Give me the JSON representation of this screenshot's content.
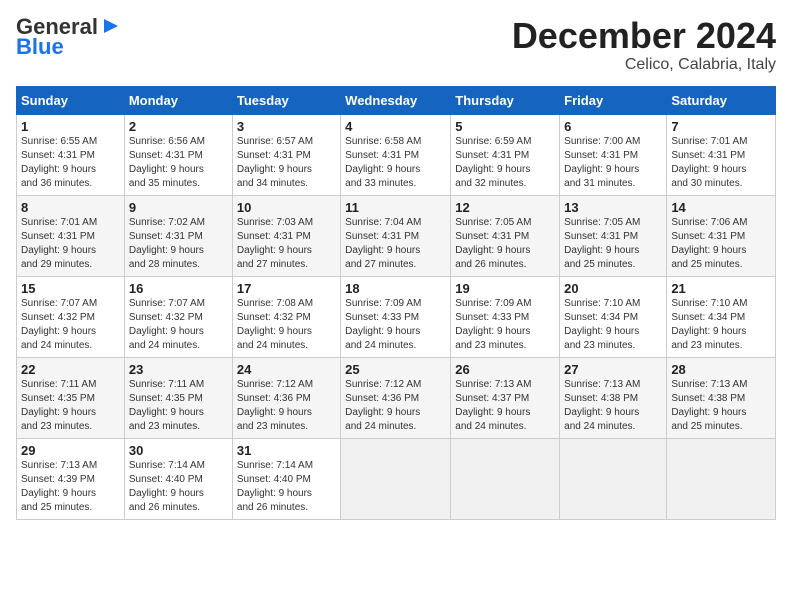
{
  "header": {
    "logo_general": "General",
    "logo_blue": "Blue",
    "month_title": "December 2024",
    "location": "Celico, Calabria, Italy"
  },
  "weekdays": [
    "Sunday",
    "Monday",
    "Tuesday",
    "Wednesday",
    "Thursday",
    "Friday",
    "Saturday"
  ],
  "weeks": [
    [
      {
        "day": "1",
        "info": "Sunrise: 6:55 AM\nSunset: 4:31 PM\nDaylight: 9 hours\nand 36 minutes."
      },
      {
        "day": "2",
        "info": "Sunrise: 6:56 AM\nSunset: 4:31 PM\nDaylight: 9 hours\nand 35 minutes."
      },
      {
        "day": "3",
        "info": "Sunrise: 6:57 AM\nSunset: 4:31 PM\nDaylight: 9 hours\nand 34 minutes."
      },
      {
        "day": "4",
        "info": "Sunrise: 6:58 AM\nSunset: 4:31 PM\nDaylight: 9 hours\nand 33 minutes."
      },
      {
        "day": "5",
        "info": "Sunrise: 6:59 AM\nSunset: 4:31 PM\nDaylight: 9 hours\nand 32 minutes."
      },
      {
        "day": "6",
        "info": "Sunrise: 7:00 AM\nSunset: 4:31 PM\nDaylight: 9 hours\nand 31 minutes."
      },
      {
        "day": "7",
        "info": "Sunrise: 7:01 AM\nSunset: 4:31 PM\nDaylight: 9 hours\nand 30 minutes."
      }
    ],
    [
      {
        "day": "8",
        "info": "Sunrise: 7:01 AM\nSunset: 4:31 PM\nDaylight: 9 hours\nand 29 minutes."
      },
      {
        "day": "9",
        "info": "Sunrise: 7:02 AM\nSunset: 4:31 PM\nDaylight: 9 hours\nand 28 minutes."
      },
      {
        "day": "10",
        "info": "Sunrise: 7:03 AM\nSunset: 4:31 PM\nDaylight: 9 hours\nand 27 minutes."
      },
      {
        "day": "11",
        "info": "Sunrise: 7:04 AM\nSunset: 4:31 PM\nDaylight: 9 hours\nand 27 minutes."
      },
      {
        "day": "12",
        "info": "Sunrise: 7:05 AM\nSunset: 4:31 PM\nDaylight: 9 hours\nand 26 minutes."
      },
      {
        "day": "13",
        "info": "Sunrise: 7:05 AM\nSunset: 4:31 PM\nDaylight: 9 hours\nand 25 minutes."
      },
      {
        "day": "14",
        "info": "Sunrise: 7:06 AM\nSunset: 4:31 PM\nDaylight: 9 hours\nand 25 minutes."
      }
    ],
    [
      {
        "day": "15",
        "info": "Sunrise: 7:07 AM\nSunset: 4:32 PM\nDaylight: 9 hours\nand 24 minutes."
      },
      {
        "day": "16",
        "info": "Sunrise: 7:07 AM\nSunset: 4:32 PM\nDaylight: 9 hours\nand 24 minutes."
      },
      {
        "day": "17",
        "info": "Sunrise: 7:08 AM\nSunset: 4:32 PM\nDaylight: 9 hours\nand 24 minutes."
      },
      {
        "day": "18",
        "info": "Sunrise: 7:09 AM\nSunset: 4:33 PM\nDaylight: 9 hours\nand 24 minutes."
      },
      {
        "day": "19",
        "info": "Sunrise: 7:09 AM\nSunset: 4:33 PM\nDaylight: 9 hours\nand 23 minutes."
      },
      {
        "day": "20",
        "info": "Sunrise: 7:10 AM\nSunset: 4:34 PM\nDaylight: 9 hours\nand 23 minutes."
      },
      {
        "day": "21",
        "info": "Sunrise: 7:10 AM\nSunset: 4:34 PM\nDaylight: 9 hours\nand 23 minutes."
      }
    ],
    [
      {
        "day": "22",
        "info": "Sunrise: 7:11 AM\nSunset: 4:35 PM\nDaylight: 9 hours\nand 23 minutes."
      },
      {
        "day": "23",
        "info": "Sunrise: 7:11 AM\nSunset: 4:35 PM\nDaylight: 9 hours\nand 23 minutes."
      },
      {
        "day": "24",
        "info": "Sunrise: 7:12 AM\nSunset: 4:36 PM\nDaylight: 9 hours\nand 23 minutes."
      },
      {
        "day": "25",
        "info": "Sunrise: 7:12 AM\nSunset: 4:36 PM\nDaylight: 9 hours\nand 24 minutes."
      },
      {
        "day": "26",
        "info": "Sunrise: 7:13 AM\nSunset: 4:37 PM\nDaylight: 9 hours\nand 24 minutes."
      },
      {
        "day": "27",
        "info": "Sunrise: 7:13 AM\nSunset: 4:38 PM\nDaylight: 9 hours\nand 24 minutes."
      },
      {
        "day": "28",
        "info": "Sunrise: 7:13 AM\nSunset: 4:38 PM\nDaylight: 9 hours\nand 25 minutes."
      }
    ],
    [
      {
        "day": "29",
        "info": "Sunrise: 7:13 AM\nSunset: 4:39 PM\nDaylight: 9 hours\nand 25 minutes."
      },
      {
        "day": "30",
        "info": "Sunrise: 7:14 AM\nSunset: 4:40 PM\nDaylight: 9 hours\nand 26 minutes."
      },
      {
        "day": "31",
        "info": "Sunrise: 7:14 AM\nSunset: 4:40 PM\nDaylight: 9 hours\nand 26 minutes."
      },
      {
        "day": "",
        "info": ""
      },
      {
        "day": "",
        "info": ""
      },
      {
        "day": "",
        "info": ""
      },
      {
        "day": "",
        "info": ""
      }
    ]
  ]
}
